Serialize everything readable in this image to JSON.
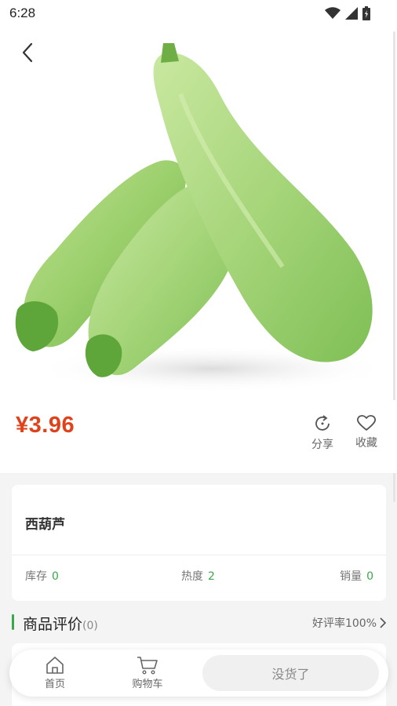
{
  "status_bar": {
    "time": "6:28"
  },
  "product": {
    "price": "¥3.96",
    "name": "西葫芦",
    "image_icon": "zucchini-image"
  },
  "actions": {
    "share_label": "分享",
    "favorite_label": "收藏"
  },
  "stats": [
    {
      "label": "库存",
      "value": "0"
    },
    {
      "label": "热度",
      "value": "2"
    },
    {
      "label": "销量",
      "value": "0"
    }
  ],
  "reviews": {
    "title": "商品评价",
    "count": "(0)",
    "rate": "好评率100%"
  },
  "bottom_bar": {
    "home_label": "首页",
    "cart_label": "购物车",
    "sold_out_label": "没货了"
  },
  "colors": {
    "price_red": "#e0421b",
    "accent_green": "#3aa84a"
  }
}
